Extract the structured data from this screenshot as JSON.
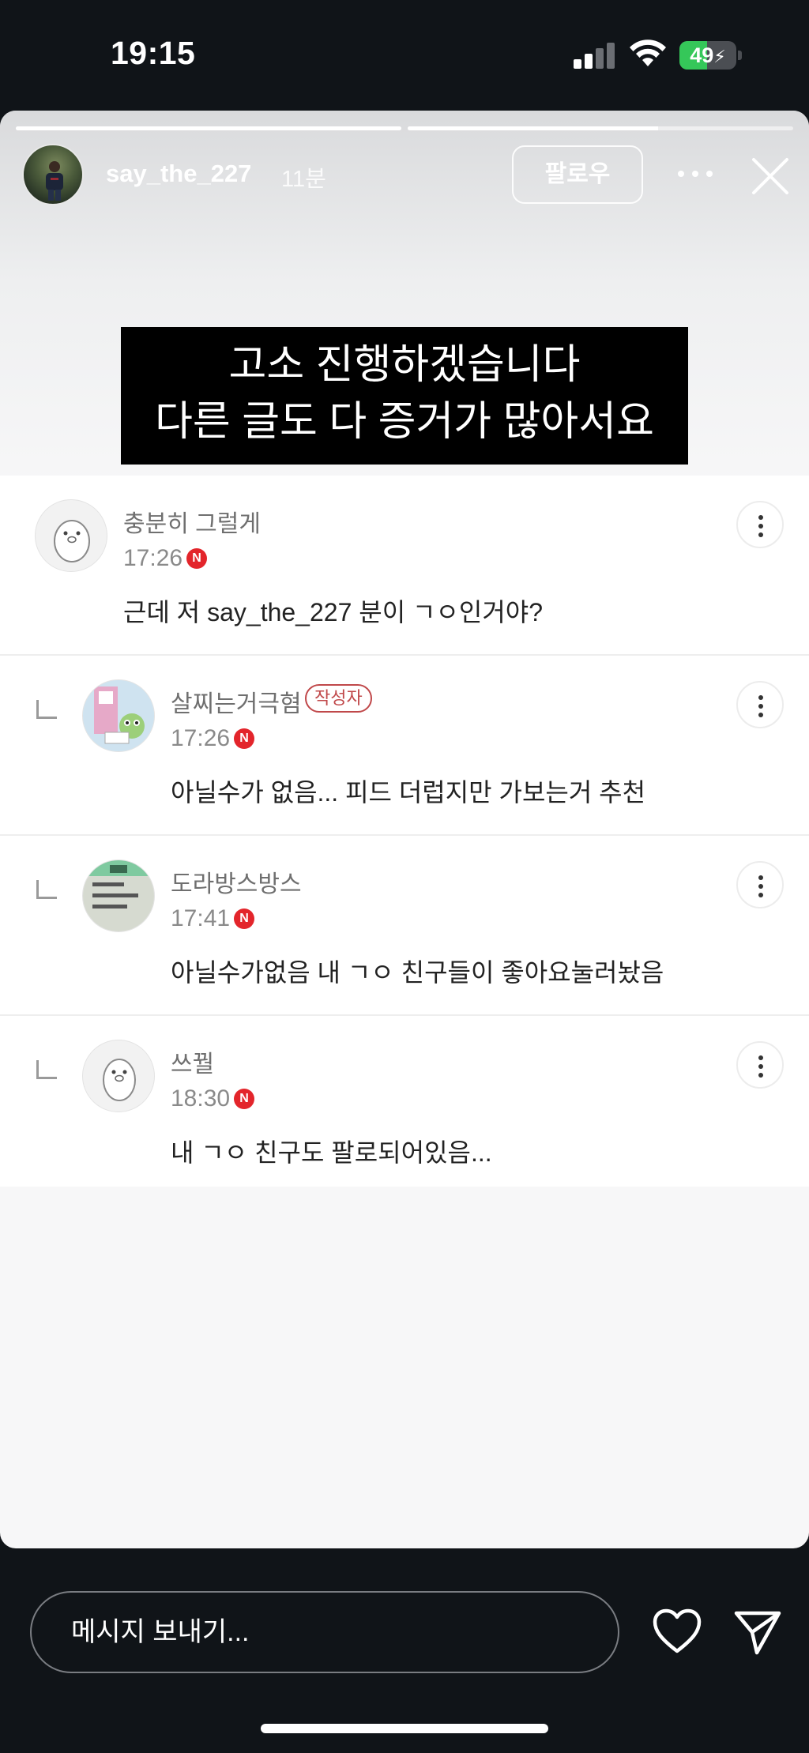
{
  "status_bar": {
    "time": "19:15",
    "battery_percent": "49",
    "battery_level": 0.49,
    "signal_icon": "cellular-signal-icon",
    "wifi_icon": "wifi-icon",
    "charging_icon": "bolt-icon"
  },
  "story": {
    "username": "say_the_227",
    "time_ago": "11분",
    "follow_label": "팔로우",
    "progress_segments": [
      1.0,
      0.65
    ],
    "caption": {
      "line1": "고소 진행하겠습니다",
      "line2": "다른 글도 다 증거가 많아서요"
    }
  },
  "comments": [
    {
      "author": "충분히 그럴게",
      "time": "17:26",
      "badge": "N",
      "text": "근데 저 say_the_227 분이 ㄱㅇ인거야?",
      "is_reply": false,
      "writer_label": ""
    },
    {
      "author": "살찌는거극혐",
      "time": "17:26",
      "badge": "N",
      "text": "아닐수가 없음... 피드 더럽지만 가보는거 추천",
      "is_reply": true,
      "writer_label": "작성자"
    },
    {
      "author": "도라방스방스",
      "time": "17:41",
      "badge": "N",
      "text": "아닐수가없음 내 ㄱㅇ 친구들이 좋아요눌러놨음",
      "is_reply": true,
      "writer_label": ""
    },
    {
      "author": "쓰꿜",
      "time": "18:30",
      "badge": "N",
      "text": "내 ㄱㅇ 친구도 팔로되어있음...",
      "is_reply": true,
      "writer_label": ""
    }
  ],
  "reply_bar": {
    "placeholder": "메시지 보내기...",
    "like_icon": "heart-icon",
    "send_icon": "paper-plane-icon"
  },
  "colors": {
    "background": "#101418",
    "card": "#f7f7f8",
    "badge_red": "#e3252b",
    "writer_badge": "#c0484a",
    "battery_green": "#35c759"
  }
}
